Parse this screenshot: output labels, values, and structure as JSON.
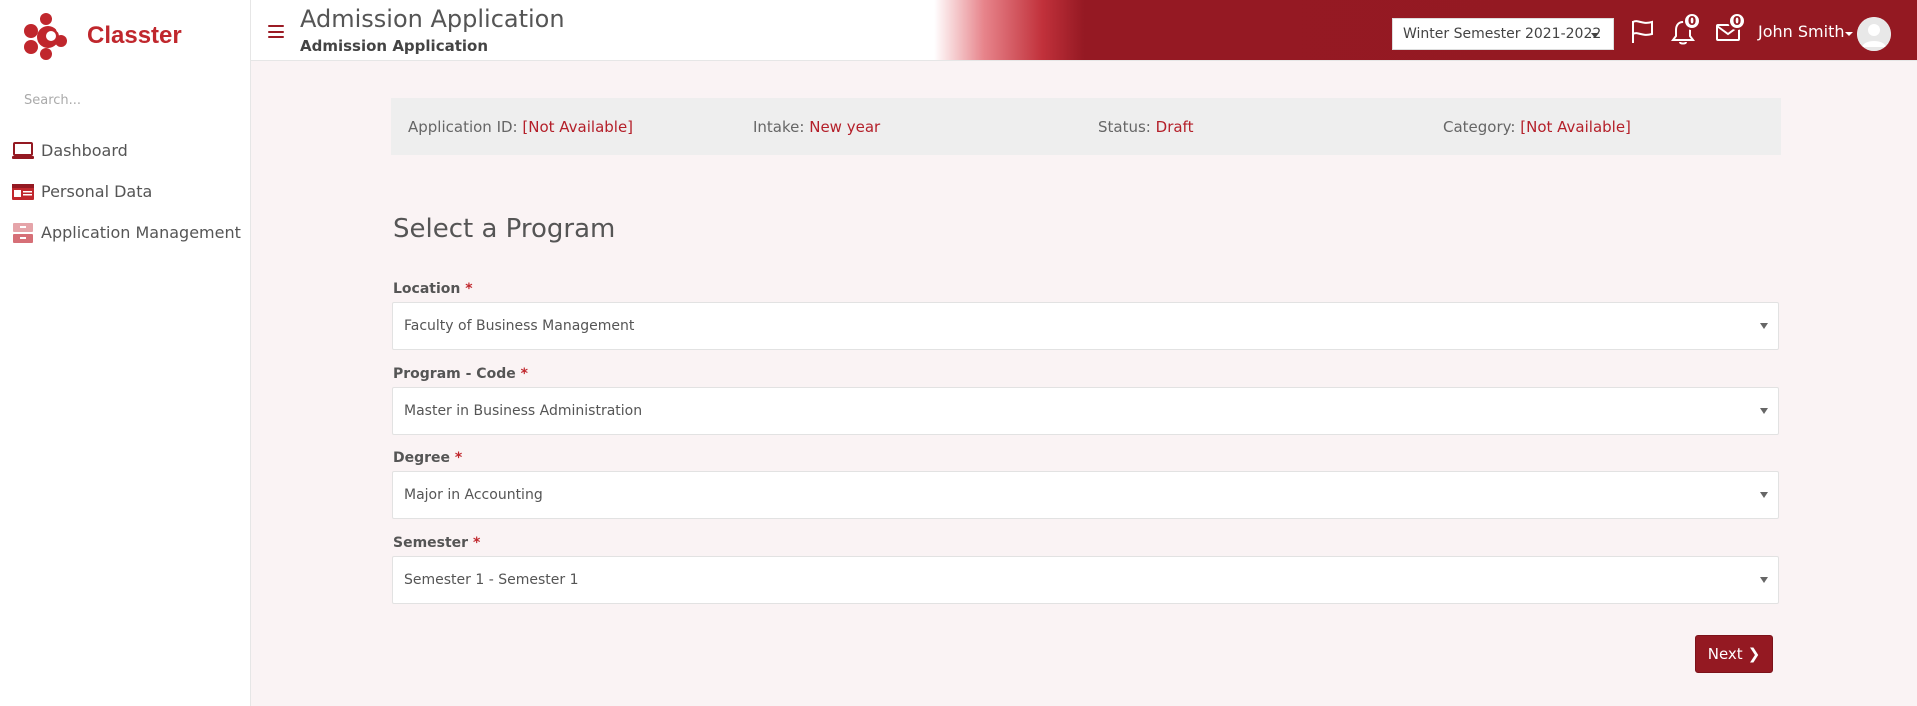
{
  "app": {
    "name": "Classter",
    "brand_color": "#c0272d",
    "accent_dark": "#941922"
  },
  "sidebar": {
    "search_placeholder": "Search...",
    "items": [
      {
        "label": "Dashboard",
        "icon": "laptop-icon"
      },
      {
        "label": "Personal Data",
        "icon": "id-card-icon"
      },
      {
        "label": "Application Management",
        "icon": "folder-icon"
      }
    ]
  },
  "header": {
    "title": "Admission Application",
    "subtitle": "Admission Application",
    "semester": "Winter Semester 2021-2022",
    "notifications_count": "0",
    "messages_count": "0",
    "user_name": "John Smith"
  },
  "info": {
    "application_id_label": "Application ID:",
    "application_id_value": "[Not Available]",
    "intake_label": "Intake:",
    "intake_value": "New year",
    "status_label": "Status:",
    "status_value": "Draft",
    "category_label": "Category:",
    "category_value": "[Not Available]"
  },
  "form": {
    "title": "Select a Program",
    "required_marker": "*",
    "fields": [
      {
        "label": "Location",
        "value": "Faculty of Business Management"
      },
      {
        "label": "Program - Code",
        "value": "Master in Business Administration"
      },
      {
        "label": "Degree",
        "value": "Major in Accounting"
      },
      {
        "label": "Semester",
        "value": "Semester 1 - Semester 1"
      }
    ],
    "next_label": "Next"
  }
}
